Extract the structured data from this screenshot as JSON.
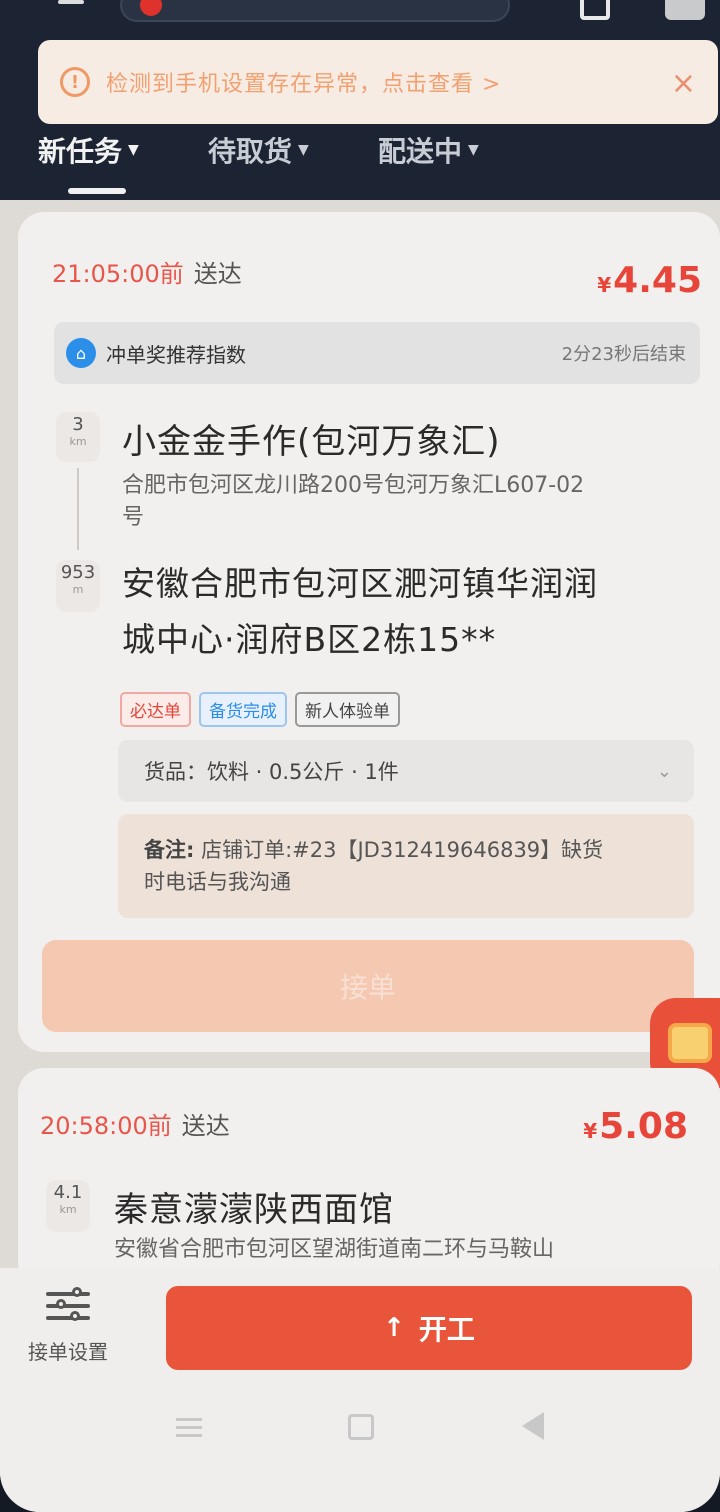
{
  "warning": {
    "text": "检测到手机设置存在异常，点击查看 >",
    "close": "×"
  },
  "tabs": [
    {
      "label": "新任务",
      "active": true
    },
    {
      "label": "待取货",
      "active": false
    },
    {
      "label": "配送中",
      "active": false
    }
  ],
  "orders": [
    {
      "deadline": "21:05:00前",
      "deadline_suffix": "送达",
      "currency": "¥",
      "price": "4.45",
      "bonus_label": "冲单奖推荐指数",
      "bonus_countdown": "2分23秒后结束",
      "pickup_distance": "3",
      "pickup_unit": "km",
      "dropoff_distance": "953",
      "dropoff_unit": "m",
      "shop_name": "小金金手作(包河万象汇)",
      "shop_address_line1": "合肥市包河区龙川路200号包河万象汇L607-02",
      "shop_address_line2": "号",
      "dest_line1": "安徽合肥市包河区淝河镇华润润",
      "dest_line2": "城中心·润府B区2栋15**",
      "tags": [
        "必达单",
        "备货完成",
        "新人体验单"
      ],
      "goods": "货品：饮料 · 0.5公斤 · 1件",
      "note_label": "备注:",
      "note_line1": " 店铺订单:#23【JD312419646839】缺货",
      "note_line2": "时电话与我沟通",
      "accept_label": "接单"
    },
    {
      "deadline": "20:58:00前",
      "deadline_suffix": "送达",
      "currency": "¥",
      "price": "5.08",
      "pickup_distance": "4.1",
      "pickup_unit": "km",
      "shop_name": "秦意濛濛陕西面馆",
      "shop_address_line1": "安徽省合肥市包河区望湖街道南二环与马鞍山"
    }
  ],
  "bottom": {
    "settings_label": "接单设置",
    "start_icon": "↑",
    "start_label": "开工"
  },
  "colors": {
    "accent": "#e8553a",
    "price": "#e8453a",
    "header_bg": "#1c2433"
  }
}
